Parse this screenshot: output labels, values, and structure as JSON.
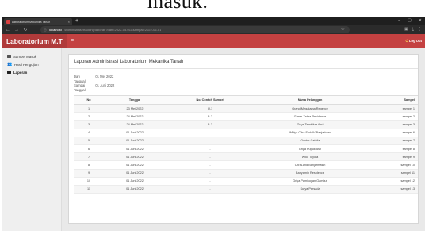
{
  "caption": {
    "fragment": "masuk."
  },
  "browser": {
    "tab_title": "Laboratorium Mekanika Tanah",
    "url_host": "localhost",
    "url_path": "/Administrasi/tracking/laporan?dari=2022-05-01&sampai=2022-06-01",
    "newtab_symbol": "+",
    "close_symbol": "×"
  },
  "app": {
    "brand": "Laboratorium M.T",
    "logout_label": "Log Out"
  },
  "sidebar": {
    "items": [
      {
        "label": "Sampel Masuk",
        "icon": "inbox-icon"
      },
      {
        "label": "Hasil Pengujian",
        "icon": "users-icon"
      },
      {
        "label": "Laporan",
        "icon": "report-icon"
      }
    ]
  },
  "report": {
    "title": "Laporan Administrasi Laboratorium Mekanika Tanah",
    "from_label": "Dari Tanggal",
    "from_value": ": 01 Mei 2022",
    "to_label": "Sampai Tanggal",
    "to_value": ": 01 Juni 2022",
    "columns": [
      "No",
      "Tanggal",
      "No. Contoh Sampel",
      "Nama Pelanggan",
      "Sampel"
    ],
    "rows": [
      [
        "1",
        "23 Mei 2022",
        "U-1",
        "Grand Megatama Regency",
        "sampel 1"
      ],
      [
        "2",
        "24 Mei 2022",
        "B-2",
        "Green Zahra Residence",
        "sampel 2"
      ],
      [
        "3",
        "24 Mei 2022",
        "B-3",
        "Griya Tembikar Asri",
        "sampel 3"
      ],
      [
        "4",
        "01 Juni 2022",
        "-",
        "Widya Citra Elok IV Banjarbaru",
        "sampel 6"
      ],
      [
        "5",
        "01 Juni 2022",
        "-",
        "Cluster Catalia",
        "sampel 7"
      ],
      [
        "6",
        "01 Juni 2022",
        "-",
        "Griya Pupuk Asri",
        "sampel 8"
      ],
      [
        "7",
        "01 Juni 2022",
        "-",
        "Wiko Toyota",
        "sampel 9"
      ],
      [
        "8",
        "01 Juni 2022",
        "-",
        "CitraLand Banjarmasin",
        "sampel 10"
      ],
      [
        "9",
        "01 Juni 2022",
        "-",
        "Banyamin Residence",
        "sampel 11"
      ],
      [
        "10",
        "01 Juni 2022",
        "-",
        "Griya Pamikoyan Gambut",
        "sampel 12"
      ],
      [
        "11",
        "01 Juni 2022",
        "-",
        "Surya Persada",
        "sampel 13"
      ]
    ]
  }
}
